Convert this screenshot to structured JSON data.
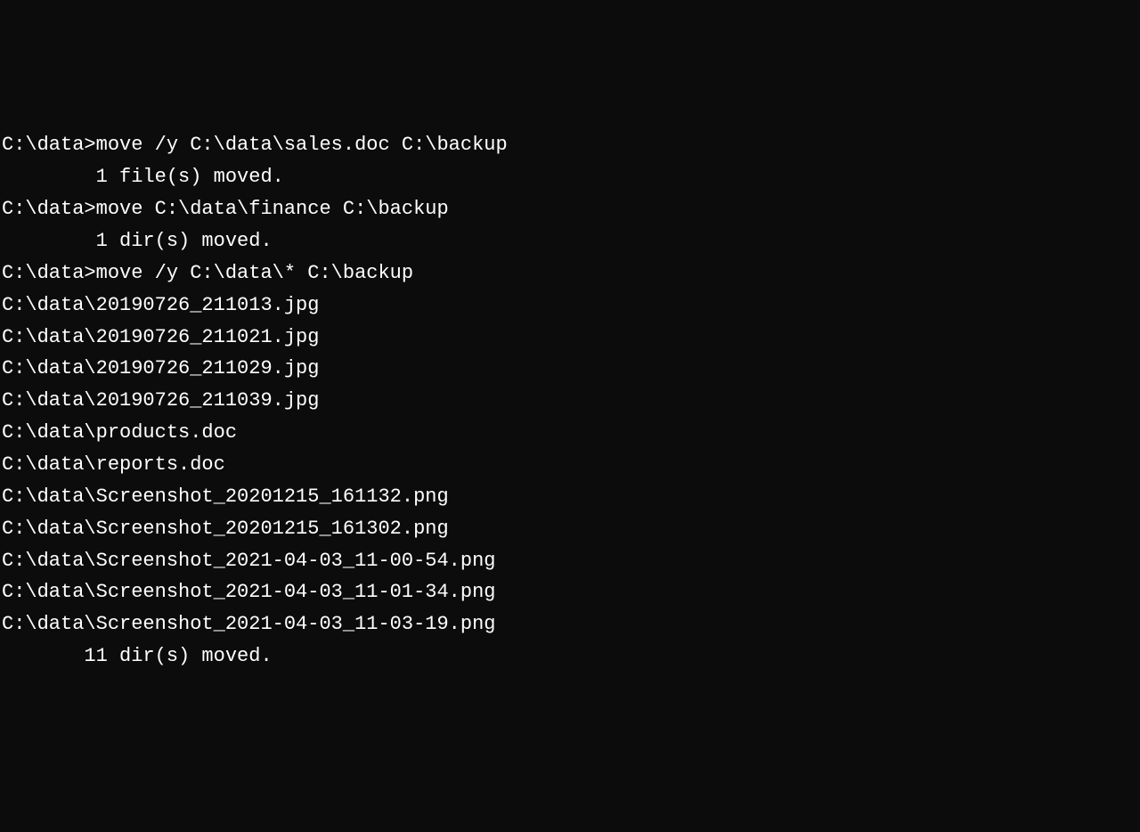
{
  "lines": [
    "C:\\data>move /y C:\\data\\sales.doc C:\\backup",
    "        1 file(s) moved.",
    "",
    "C:\\data>move C:\\data\\finance C:\\backup",
    "        1 dir(s) moved.",
    "",
    "C:\\data>move /y C:\\data\\* C:\\backup",
    "C:\\data\\20190726_211013.jpg",
    "C:\\data\\20190726_211021.jpg",
    "C:\\data\\20190726_211029.jpg",
    "C:\\data\\20190726_211039.jpg",
    "C:\\data\\products.doc",
    "C:\\data\\reports.doc",
    "C:\\data\\Screenshot_20201215_161132.png",
    "C:\\data\\Screenshot_20201215_161302.png",
    "C:\\data\\Screenshot_2021-04-03_11-00-54.png",
    "C:\\data\\Screenshot_2021-04-03_11-01-34.png",
    "C:\\data\\Screenshot_2021-04-03_11-03-19.png",
    "       11 dir(s) moved."
  ]
}
